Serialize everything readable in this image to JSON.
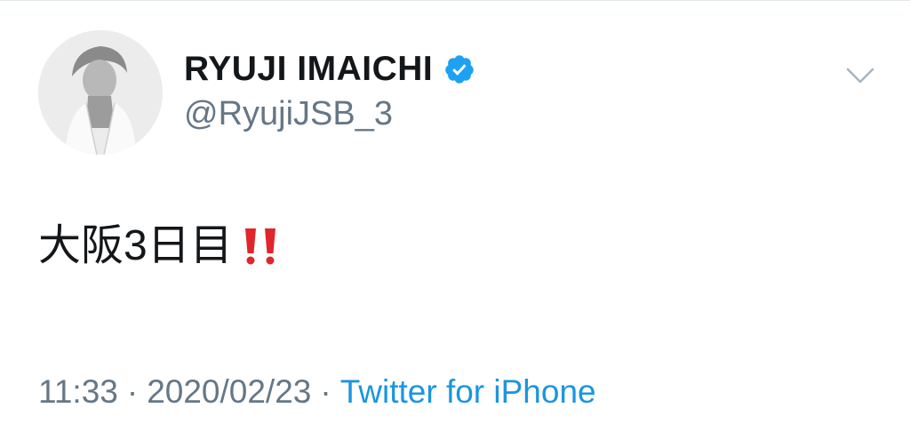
{
  "tweet": {
    "author": {
      "display_name": "RYUJI IMAICHI",
      "handle": "@RyujiJSB_3",
      "verified": true
    },
    "text": "大阪3日目",
    "text_emoji": "double-exclamation-mark",
    "meta": {
      "time": "11:33",
      "separator": "·",
      "date": "2020/02/23",
      "source": "Twitter for iPhone"
    }
  },
  "icons": {
    "verified": "verified-badge-icon",
    "caret": "chevron-down-icon",
    "emoji": "double-exclamation-icon"
  },
  "colors": {
    "verified_blue": "#1da1f2",
    "source_link": "#1b95e0",
    "secondary_text": "#657786",
    "primary_text": "#14171a",
    "emoji_red": "#e0262b"
  }
}
